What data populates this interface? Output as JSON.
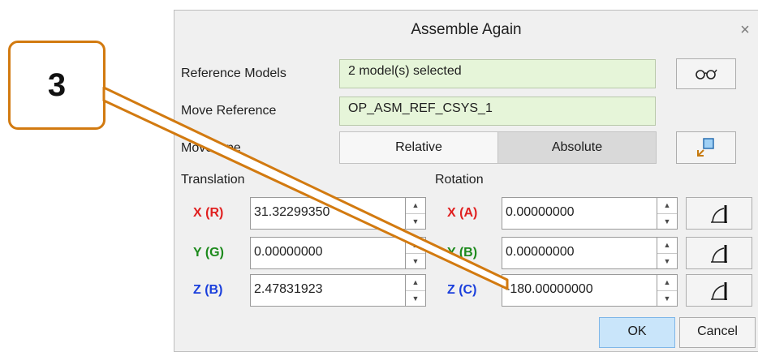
{
  "callout": {
    "number": "3"
  },
  "dialog": {
    "title": "Assemble Again",
    "close_glyph": "×",
    "reference_models": {
      "label": "Reference Models",
      "value": "2 model(s) selected",
      "button_icon": "glasses-icon",
      "button_glyph": "ōō"
    },
    "move_reference": {
      "label": "Move Reference",
      "value": "OP_ASM_REF_CSYS_1"
    },
    "move_type": {
      "label": "Move type",
      "options": [
        "Relative",
        "Absolute"
      ],
      "selected": "Absolute",
      "button_icon": "reorient-icon"
    },
    "translation": {
      "heading": "Translation",
      "rows": [
        {
          "axis": "X (R)",
          "value": "31.32299350"
        },
        {
          "axis": "Y (G)",
          "value": "0.00000000"
        },
        {
          "axis": "Z (B)",
          "value": "2.47831923"
        }
      ]
    },
    "rotation": {
      "heading": "Rotation",
      "rows": [
        {
          "axis": "X (A)",
          "value": "0.00000000"
        },
        {
          "axis": "Y (B)",
          "value": "0.00000000"
        },
        {
          "axis": "Z (C)",
          "value": "-180.00000000"
        }
      ]
    },
    "buttons": {
      "ok": "OK",
      "cancel": "Cancel"
    }
  },
  "colors": {
    "callout_border": "#d27a10",
    "field_green": "#e6f5d9",
    "axis_red": "#e02020",
    "axis_green": "#1c8a1c",
    "axis_blue": "#1a3fdc",
    "ok_blue": "#c9e5fa"
  }
}
